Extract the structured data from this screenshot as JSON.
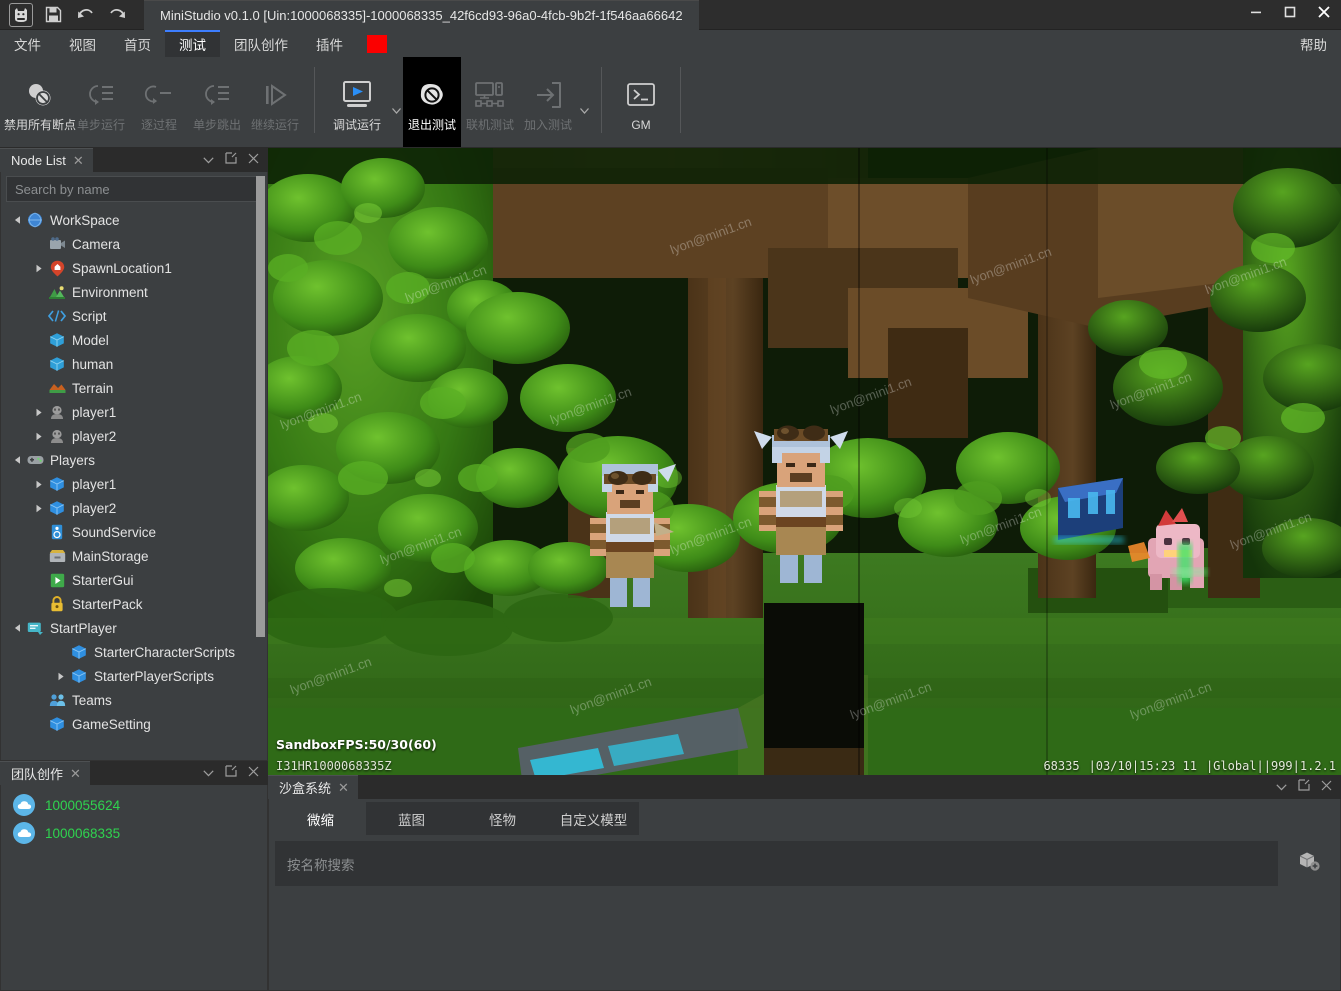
{
  "window": {
    "title": "MiniStudio v0.1.0 [Uin:1000068335]-1000068335_42f6cd93-96a0-4fcb-9b2f-1f546aa66642",
    "logo_icon": "ministudio-logo-icon",
    "save_icon": "save-icon",
    "undo_icon": "undo-icon",
    "redo_icon": "redo-icon",
    "minimize_icon": "minimize-icon",
    "maximize_icon": "maximize-icon",
    "close_icon": "close-icon"
  },
  "menubar": {
    "items": [
      {
        "label": "文件",
        "active": false
      },
      {
        "label": "视图",
        "active": false
      },
      {
        "label": "首页",
        "active": false
      },
      {
        "label": "测试",
        "active": true
      },
      {
        "label": "团队创作",
        "active": false
      },
      {
        "label": "插件",
        "active": false
      }
    ],
    "indicator_color": "#fb0000",
    "help_label": "帮助"
  },
  "ribbon": {
    "groups": [
      {
        "buttons": [
          {
            "label": "禁用所有断点",
            "icon": "disable-all-breakpoints-icon",
            "state": "enabled",
            "caret": false
          },
          {
            "label": "单步运行",
            "icon": "step-into-icon",
            "state": "disabled",
            "caret": false
          },
          {
            "label": "逐过程",
            "icon": "step-over-icon",
            "state": "disabled",
            "caret": false
          },
          {
            "label": "单步跳出",
            "icon": "step-out-icon",
            "state": "disabled",
            "caret": false
          },
          {
            "label": "继续运行",
            "icon": "resume-icon",
            "state": "disabled",
            "caret": false
          }
        ]
      },
      {
        "buttons": [
          {
            "label": "调试运行",
            "icon": "debug-run-icon",
            "state": "enabled",
            "caret": true
          },
          {
            "label": "退出测试",
            "icon": "stop-test-icon",
            "state": "selected",
            "caret": false
          },
          {
            "label": "联机测试",
            "icon": "multiplayer-test-icon",
            "state": "disabled",
            "caret": false
          },
          {
            "label": "加入测试",
            "icon": "join-test-icon",
            "state": "disabled",
            "caret": true
          }
        ]
      },
      {
        "buttons": [
          {
            "label": "GM",
            "icon": "console-icon",
            "state": "enabled",
            "caret": false
          }
        ]
      }
    ]
  },
  "node_panel": {
    "tab_label": "Node List",
    "tab_close_icon": "close-icon",
    "actions": [
      {
        "icon": "chevron-down-icon",
        "name": "panel-menu-icon"
      },
      {
        "icon": "float-panel-icon",
        "name": "undock-icon"
      },
      {
        "icon": "close-icon",
        "name": "panel-close-icon"
      }
    ],
    "search_placeholder": "Search by name",
    "tree": [
      {
        "label": "WorkSpace",
        "depth": 0,
        "twisty": "open",
        "icon": "globe-icon"
      },
      {
        "label": "Camera",
        "depth": 1,
        "twisty": "none",
        "icon": "camera-icon"
      },
      {
        "label": "SpawnLocation1",
        "depth": 1,
        "twisty": "closed",
        "icon": "spawn-pin-icon"
      },
      {
        "label": "Environment",
        "depth": 1,
        "twisty": "none",
        "icon": "environment-icon"
      },
      {
        "label": "Script",
        "depth": 1,
        "twisty": "none",
        "icon": "script-icon"
      },
      {
        "label": "Model",
        "depth": 1,
        "twisty": "none",
        "icon": "model-cube-icon"
      },
      {
        "label": "human",
        "depth": 1,
        "twisty": "none",
        "icon": "model-cube-icon"
      },
      {
        "label": "Terrain",
        "depth": 1,
        "twisty": "none",
        "icon": "terrain-icon"
      },
      {
        "label": "player1",
        "depth": 1,
        "twisty": "closed",
        "icon": "avatar-gray-icon"
      },
      {
        "label": "player2",
        "depth": 1,
        "twisty": "closed",
        "icon": "avatar-gray-icon"
      },
      {
        "label": "Players",
        "depth": 0,
        "twisty": "open",
        "icon": "gamepad-icon"
      },
      {
        "label": "player1",
        "depth": 1,
        "twisty": "closed",
        "icon": "blue-cube-icon"
      },
      {
        "label": "player2",
        "depth": 1,
        "twisty": "closed",
        "icon": "blue-cube-icon"
      },
      {
        "label": "SoundService",
        "depth": 1,
        "twisty": "none",
        "icon": "speaker-icon"
      },
      {
        "label": "MainStorage",
        "depth": 1,
        "twisty": "none",
        "icon": "storage-icon"
      },
      {
        "label": "StarterGui",
        "depth": 1,
        "twisty": "none",
        "icon": "starter-gui-icon"
      },
      {
        "label": "StarterPack",
        "depth": 1,
        "twisty": "none",
        "icon": "lock-icon"
      },
      {
        "label": "StartPlayer",
        "depth": 0,
        "twisty": "open",
        "icon": "start-player-icon"
      },
      {
        "label": "StarterCharacterScripts",
        "depth": 2,
        "twisty": "none",
        "icon": "blue-cube-icon"
      },
      {
        "label": "StarterPlayerScripts",
        "depth": 2,
        "twisty": "closed",
        "icon": "blue-cube-icon"
      },
      {
        "label": "Teams",
        "depth": 1,
        "twisty": "none",
        "icon": "teams-icon"
      },
      {
        "label": "GameSetting",
        "depth": 1,
        "twisty": "none",
        "icon": "blue-cube-icon"
      }
    ]
  },
  "team_panel": {
    "tab_label": "团队创作",
    "tab_close_icon": "close-icon",
    "actions": [
      {
        "icon": "chevron-down-icon",
        "name": "panel-menu-icon"
      },
      {
        "icon": "float-panel-icon",
        "name": "undock-icon"
      },
      {
        "icon": "close-icon",
        "name": "panel-close-icon"
      }
    ],
    "members": [
      {
        "id": "1000055624",
        "avatar_icon": "cloud-avatar-icon"
      },
      {
        "id": "1000068335",
        "avatar_icon": "cloud-avatar-icon"
      }
    ],
    "member_color": "#2fd34f"
  },
  "viewport": {
    "fps_text": "SandboxFPS:50/30(60)",
    "session_text": "I31HR1000068335Z",
    "status_right": [
      "68335",
      "|03/10|15:23 11",
      "|Global||999|1.2.1"
    ],
    "watermark_text": "lyon@mini1.cn",
    "scene_description": "3D voxel game scene: jungle canopy with dense green leaves, wooden tree trunks and plank platforms, two player avatars in pilot helmets with goggles on a grass lawn, a pink creature and glowing blue crystal blocks at right"
  },
  "bottom_panel": {
    "tab_label": "沙盒系统",
    "tab_close_icon": "close-icon",
    "actions": [
      {
        "icon": "chevron-down-icon",
        "name": "panel-menu-icon"
      },
      {
        "icon": "float-panel-icon",
        "name": "undock-icon"
      },
      {
        "icon": "close-icon",
        "name": "panel-close-icon"
      }
    ],
    "tabs": [
      {
        "label": "微缩",
        "active": true
      },
      {
        "label": "蓝图",
        "active": false
      },
      {
        "label": "怪物",
        "active": false
      },
      {
        "label": "自定义模型",
        "active": false
      }
    ],
    "search_placeholder": "按名称搜索",
    "add_icon": "add-model-icon"
  },
  "colors": {
    "chrome": "#3c3f41",
    "panel_bg": "#3c3f41",
    "app_bg": "#2b2b2b",
    "input_bg": "#313335",
    "accent_blue": "#3d7eff",
    "selected_black": "#000000",
    "text": "#d6d6d6",
    "text_dim": "#6e7173",
    "green_text": "#2fd34f",
    "menu_red": "#fb0000"
  }
}
